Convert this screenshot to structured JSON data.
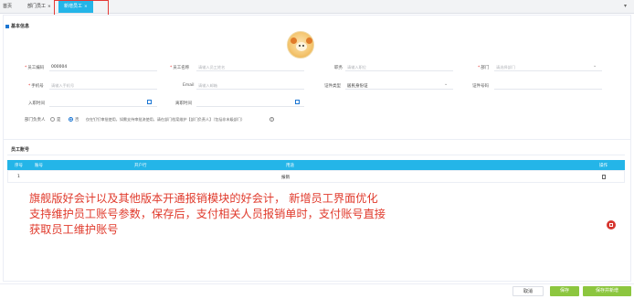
{
  "tabs": [
    {
      "label": "首页"
    },
    {
      "label": "部门员工",
      "close": "×"
    },
    {
      "label": "新增员工",
      "close": "×",
      "active": true
    }
  ],
  "basic_info": {
    "title": "基本信息",
    "fields": {
      "employee_code": {
        "label": "员工编码",
        "value": "000004",
        "required": true
      },
      "employee_name": {
        "label": "员工名称",
        "placeholder": "请输入员工姓名",
        "required": true
      },
      "position": {
        "label": "职务",
        "placeholder": "请输入职位"
      },
      "department": {
        "label": "部门",
        "placeholder": "请选择部门",
        "required": true
      },
      "phone": {
        "label": "手机号",
        "placeholder": "请输入手机号",
        "required": true
      },
      "email": {
        "label": "Email",
        "placeholder": "请输入邮箱"
      },
      "id_type": {
        "label": "证件类型",
        "value": "居民身份证"
      },
      "id_number": {
        "label": "证件号码"
      },
      "hire_date": {
        "label": "入职时间"
      },
      "leave_date": {
        "label": "离职时间"
      }
    },
    "dept_head": {
      "label": "部门负责人",
      "options": [
        {
          "label": "是",
          "selected": false
        },
        {
          "label": "否",
          "selected": true
        }
      ],
      "hint": "仅在钉钉审批使用，如需支持审批流使用，请在部门档案维护【部门负责人】（包括非末级部门）"
    }
  },
  "account": {
    "title": "员工账号",
    "columns": [
      "序号",
      "账号",
      "开户行",
      "用途",
      "操作"
    ],
    "rows": [
      {
        "index": "1",
        "account": "",
        "bank": "",
        "purpose": "报销"
      }
    ]
  },
  "annotation": {
    "lines": [
      "旗舰版好会计以及其他版本开通报销模块的好会计，  新增员工界面优化",
      "支持维护员工账号参数，保存后，支付相关人员报销单时，支付账号直接",
      "获取员工维护账号"
    ]
  },
  "footer": {
    "cancel": "取消",
    "save": "保存",
    "save_new": "保存并新增"
  },
  "colors": {
    "accent": "#24b5e8",
    "save_green": "#8cc63f",
    "annotation_red": "#e03a2c"
  }
}
